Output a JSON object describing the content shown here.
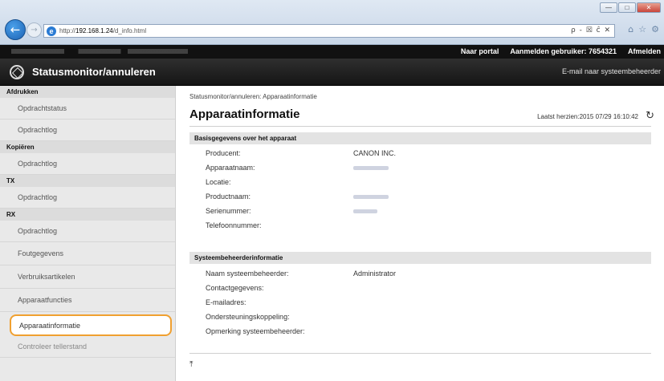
{
  "browser": {
    "url_prefix": "http://",
    "url_host": "192.168.1.24",
    "url_path": "/d_info.html",
    "addr_tools": "ρ - ☒ ĉ ✕",
    "window_buttons": [
      "—",
      "□",
      "✕"
    ],
    "toolbar_icons": [
      "⌂",
      "☆",
      "⚙"
    ]
  },
  "topbar": {
    "links": [
      "Naar portal",
      "Aanmelden gebruiker:  7654321",
      "Afmelden"
    ]
  },
  "header": {
    "title": "Statusmonitor/annuleren",
    "email_link": "E-mail naar systeembeheerder"
  },
  "sidebar": {
    "groups": [
      {
        "heading": "Afdrukken",
        "items": [
          "Opdrachtstatus",
          "Opdrachtlog"
        ]
      },
      {
        "heading": "Kopiëren",
        "items": [
          "Opdrachtlog"
        ]
      },
      {
        "heading": "TX",
        "items": [
          "Opdrachtlog"
        ]
      },
      {
        "heading": "RX",
        "items": [
          "Opdrachtlog"
        ]
      }
    ],
    "extra_items": [
      "Foutgegevens",
      "Verbruiksartikelen",
      "Apparaatfuncties",
      "Apparaatinformatie",
      "Controleer tellerstand"
    ]
  },
  "main": {
    "breadcrumb": "Statusmonitor/annuleren: Apparaatinformatie",
    "title": "Apparaatinformatie",
    "last_updated": "Laatst herzien:2015 07/29 16:10:42",
    "refresh_icon": "↻",
    "section1": {
      "heading": "Basisgegevens over het apparaat",
      "rows": [
        {
          "label": "Producent:",
          "value": "CANON INC."
        },
        {
          "label": "Apparaatnaam:",
          "value": ""
        },
        {
          "label": "Locatie:",
          "value": ""
        },
        {
          "label": "Productnaam:",
          "value": ""
        },
        {
          "label": "Serienummer:",
          "value": ""
        },
        {
          "label": "Telefoonnummer:",
          "value": ""
        }
      ]
    },
    "section2": {
      "heading": "Systeembeheerderinformatie",
      "rows": [
        {
          "label": "Naam systeembeheerder:",
          "value": "Administrator"
        },
        {
          "label": "Contactgegevens:",
          "value": ""
        },
        {
          "label": "E-mailadres:",
          "value": ""
        },
        {
          "label": "Ondersteuningskoppeling:",
          "value": ""
        },
        {
          "label": "Opmerking systeembeheerder:",
          "value": ""
        }
      ]
    },
    "top_link_icon": "⤒"
  },
  "colors": {
    "selected_outline": "#f0a030",
    "title_bar": "#1e1e1e",
    "top_bar": "#111111"
  }
}
